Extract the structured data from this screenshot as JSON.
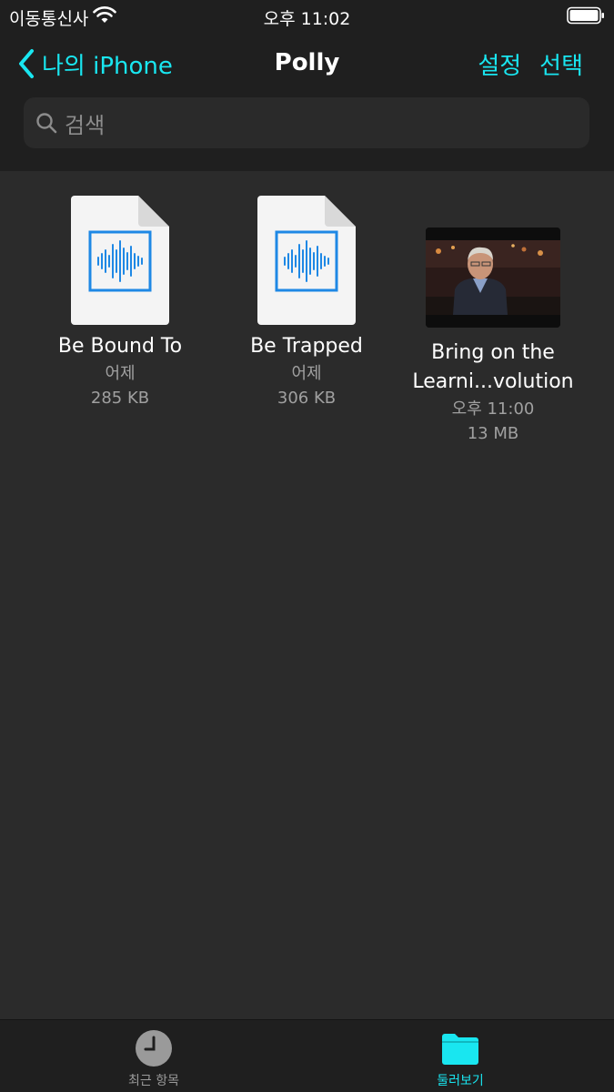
{
  "status_bar": {
    "carrier": "이동통신사",
    "time": "오후 11:02"
  },
  "nav": {
    "back_label": "나의 iPhone",
    "title": "Polly",
    "settings_label": "설정",
    "select_label": "선택"
  },
  "search": {
    "placeholder": "검색"
  },
  "files": [
    {
      "name": "Be Bound To",
      "date": "어제",
      "size": "285 KB",
      "type": "audio"
    },
    {
      "name": "Be Trapped",
      "date": "어제",
      "size": "306 KB",
      "type": "audio"
    },
    {
      "name_line1": "Bring on the",
      "name_line2": "Learni...volution",
      "date": "오후 11:00",
      "size": "13 MB",
      "type": "video"
    }
  ],
  "tabs": [
    {
      "label": "최근 항목",
      "icon": "clock-icon",
      "active": false
    },
    {
      "label": "둘러보기",
      "icon": "folder-icon",
      "active": true
    }
  ],
  "colors": {
    "accent": "#19e6f0",
    "background": "#2b2b2b",
    "bars": "#1f1f1f",
    "audio_icon": "#1e88e5"
  }
}
